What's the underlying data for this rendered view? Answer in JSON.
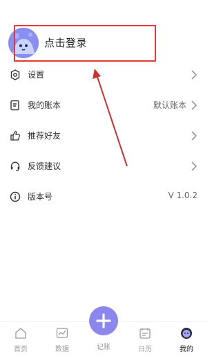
{
  "profile": {
    "login_label": "点击登录",
    "avatar_color": "#8a8ef0"
  },
  "menu": {
    "items": [
      {
        "label": "设置",
        "value": "",
        "icon": "gear-icon",
        "chevron": true
      },
      {
        "label": "我的账本",
        "value": "默认账本",
        "icon": "ledger-icon",
        "chevron": true
      },
      {
        "label": "推荐好友",
        "value": "",
        "icon": "thumbs-up-icon",
        "chevron": true
      },
      {
        "label": "反馈建议",
        "value": "",
        "icon": "headset-icon",
        "chevron": true
      },
      {
        "label": "版本号",
        "value": "V 1.0.2",
        "icon": "info-icon",
        "chevron": false
      }
    ]
  },
  "bottom_nav": {
    "items": [
      {
        "label": "首页",
        "icon": "home-icon",
        "active": false
      },
      {
        "label": "数据",
        "icon": "chart-icon",
        "active": false
      },
      {
        "label": "记账",
        "icon": "plus-icon",
        "active": false
      },
      {
        "label": "日历",
        "icon": "calendar-icon",
        "active": false
      },
      {
        "label": "我的",
        "icon": "profile-icon",
        "active": true
      }
    ]
  },
  "colors": {
    "accent": "#8b87ef",
    "highlight_box": "#e53935",
    "arrow": "#d32f2f"
  }
}
